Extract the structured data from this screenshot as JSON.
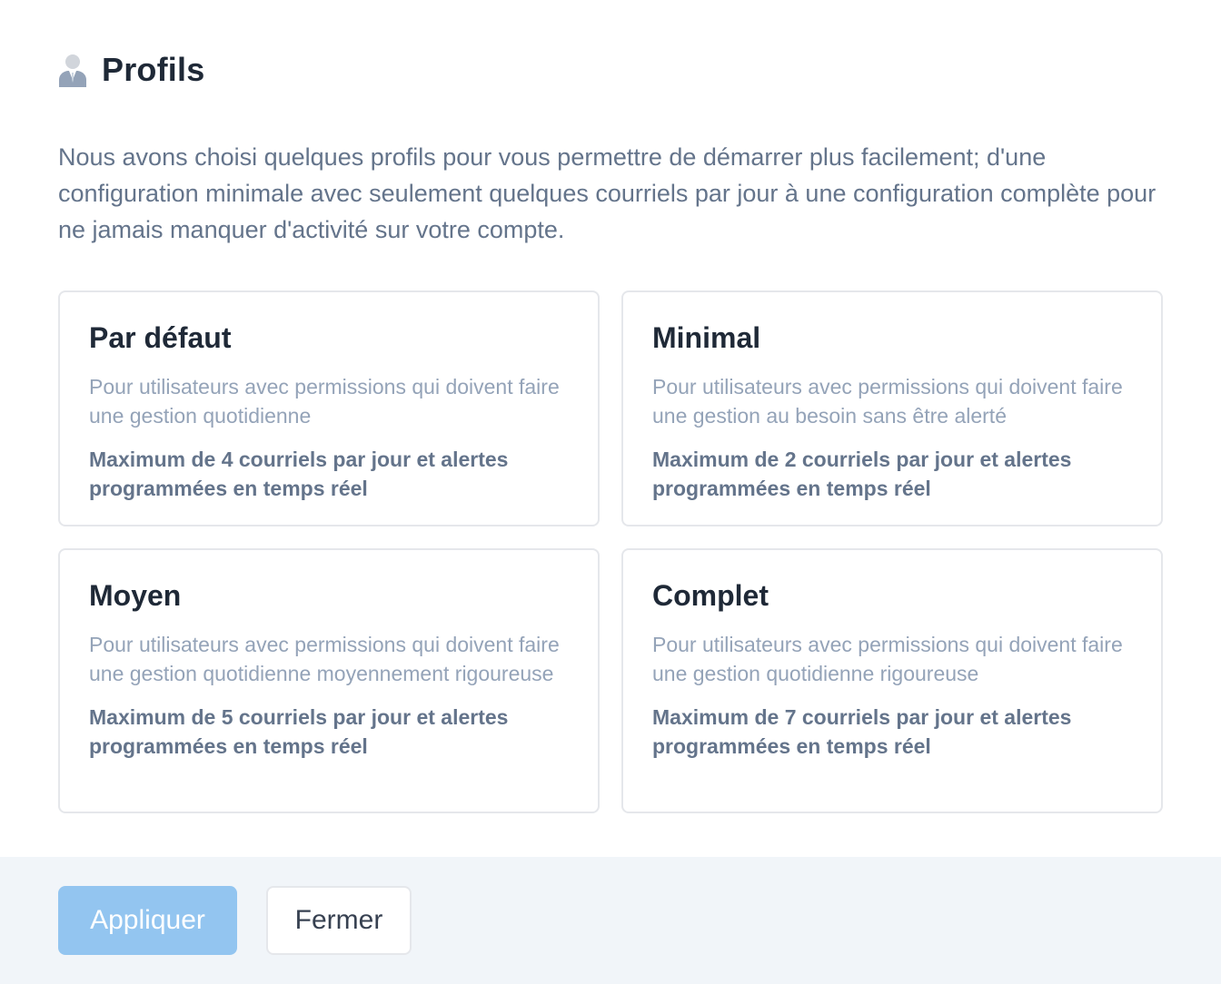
{
  "header": {
    "icon": "user-icon",
    "title": "Profils"
  },
  "intro": "Nous avons choisi quelques profils pour vous permettre de démarrer plus facilement; d'une configuration minimale avec seulement quelques courriels par jour à une configuration complète pour ne jamais manquer d'activité sur votre compte.",
  "profiles": [
    {
      "title": "Par défaut",
      "description": "Pour utilisateurs avec permissions qui doivent faire une gestion quotidienne",
      "detail": "Maximum de 4 courriels par jour et alertes programmées en temps réel"
    },
    {
      "title": "Minimal",
      "description": "Pour utilisateurs avec permissions qui doivent faire une gestion au besoin sans être alerté",
      "detail": "Maximum de 2 courriels par jour et alertes programmées en temps réel"
    },
    {
      "title": "Moyen",
      "description": "Pour utilisateurs avec permissions qui doivent faire une gestion quotidienne moyennement rigoureuse",
      "detail": "Maximum de 5 courriels par jour et alertes programmées en temps réel"
    },
    {
      "title": "Complet",
      "description": "Pour utilisateurs avec permissions qui doivent faire une gestion quotidienne rigoureuse",
      "detail": "Maximum de 7 courriels par jour et alertes programmées en temps réel"
    }
  ],
  "footer": {
    "apply_label": "Appliquer",
    "close_label": "Fermer"
  },
  "colors": {
    "apply_button": "#93c5f0",
    "footer_background": "#f1f5f9",
    "card_border": "#e5e7eb"
  }
}
